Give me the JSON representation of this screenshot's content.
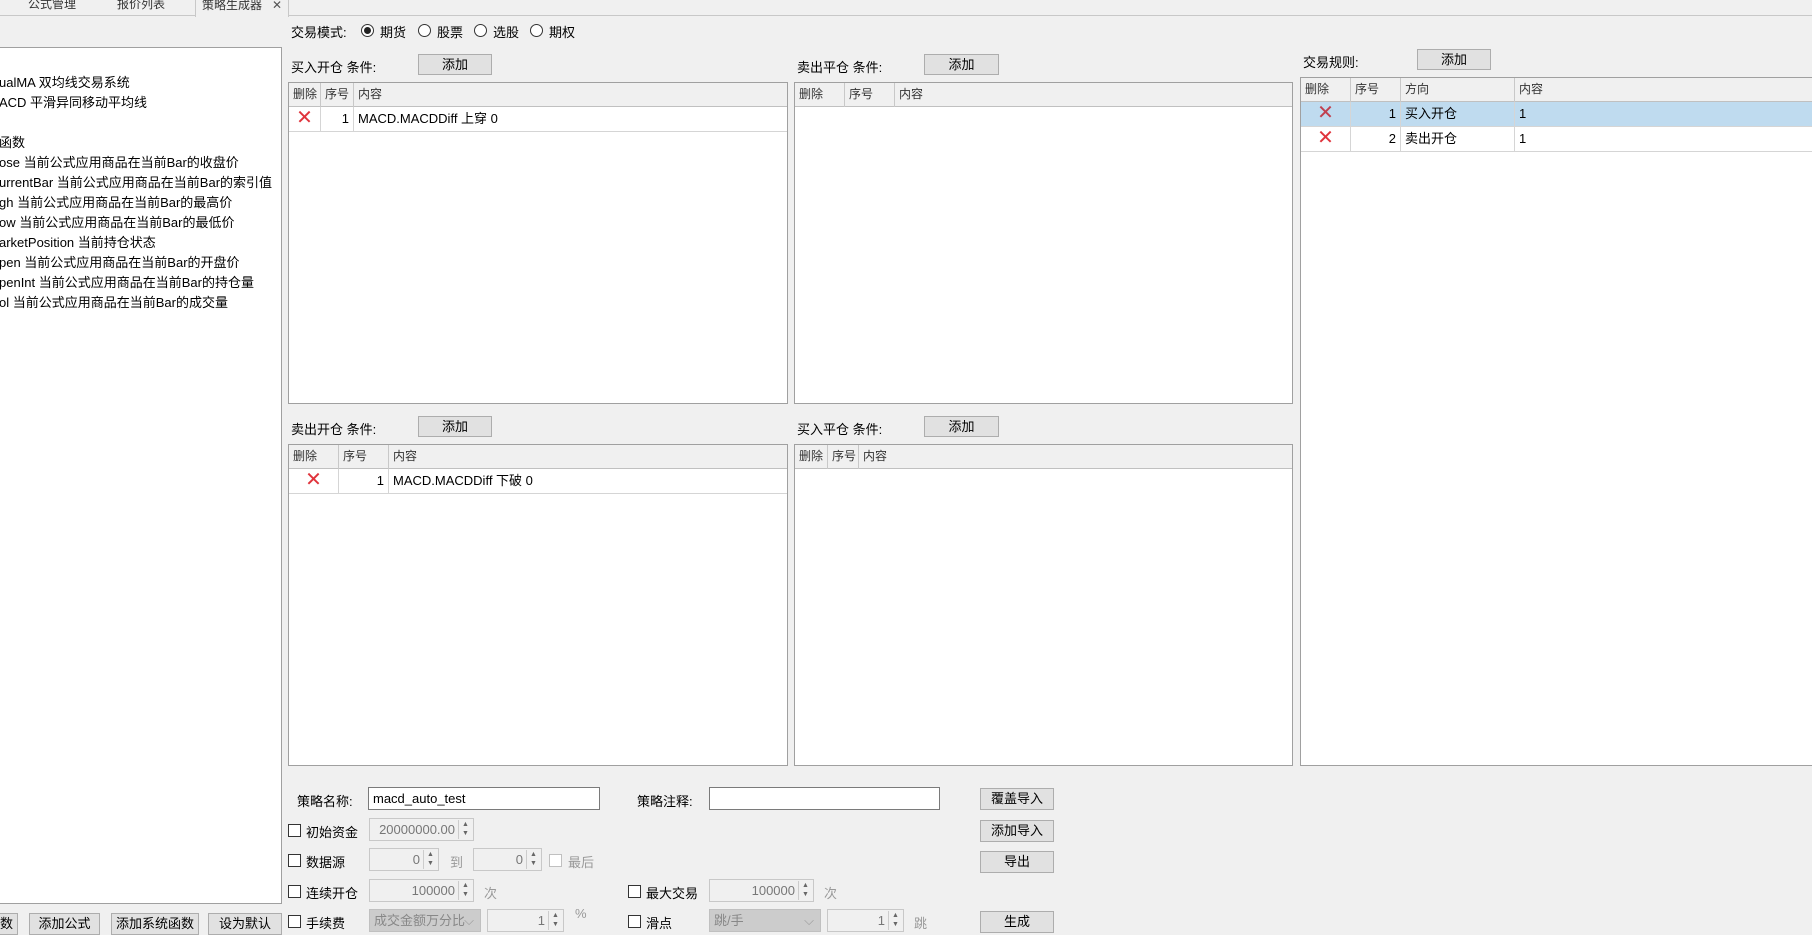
{
  "tabs": [
    "公式管理",
    "报价列表",
    "策略生成器"
  ],
  "close_glyph": "✕",
  "trade_mode": {
    "label": "交易模式:",
    "options": [
      "期货",
      "股票",
      "选股",
      "期权"
    ],
    "selected": "期货"
  },
  "left_list": [
    "ualMA 双均线交易系统",
    "ACD 平滑异同移动平均线",
    "",
    "函数",
    "ose 当前公式应用商品在当前Bar的收盘价",
    "urrentBar 当前公式应用商品在当前Bar的索引值",
    "gh 当前公式应用商品在当前Bar的最高价",
    "ow 当前公式应用商品在当前Bar的最低价",
    "arketPosition 当前持仓状态",
    "pen 当前公式应用商品在当前Bar的开盘价",
    "penInt 当前公式应用商品在当前Bar的持仓量",
    "ol 当前公式应用商品在当前Bar的成交量"
  ],
  "left_buttons": [
    "数",
    "添加公式",
    "添加系统函数",
    "设为默认"
  ],
  "add_label": "添加",
  "delete_glyph": "✕",
  "cols": {
    "del": "删除",
    "seq": "序号",
    "content": "内容",
    "direction": "方向"
  },
  "buy_open": {
    "label": "买入开仓 条件:",
    "rows": [
      {
        "seq": "1",
        "content": "MACD.MACDDiff 上穿 0"
      }
    ]
  },
  "sell_close": {
    "label": "卖出平仓 条件:"
  },
  "sell_open": {
    "label": "卖出开仓 条件:",
    "rows": [
      {
        "seq": "1",
        "content": "MACD.MACDDiff 下破 0"
      }
    ]
  },
  "buy_close": {
    "label": "买入平仓 条件:"
  },
  "rules": {
    "label": "交易规则:",
    "rows": [
      {
        "seq": "1",
        "direction": "买入开仓",
        "content": "1",
        "selected": true
      },
      {
        "seq": "2",
        "direction": "卖出开仓",
        "content": "1",
        "selected": false
      }
    ]
  },
  "form": {
    "name_label": "策略名称:",
    "name_value": "macd_auto_test",
    "note_label": "策略注释:",
    "note_value": "",
    "init_cap_label": "初始资金",
    "init_cap_value": "20000000.00",
    "datasrc_label": "数据源",
    "datasrc_from": "0",
    "to_label": "到",
    "datasrc_to": "0",
    "last_label": "最后",
    "cont_open_label": "连续开仓",
    "cont_open_value": "100000",
    "times_label": "次",
    "max_trade_label": "最大交易",
    "max_trade_value": "100000",
    "fee_label": "手续费",
    "fee_type": "成交金额万分比",
    "fee_value": "1",
    "percent": "%",
    "slip_label": "滑点",
    "slip_type": "跳/手",
    "slip_value": "1",
    "tick_label": "跳",
    "btn_overwrite": "覆盖导入",
    "btn_append": "添加导入",
    "btn_export": "导出",
    "btn_generate": "生成"
  }
}
